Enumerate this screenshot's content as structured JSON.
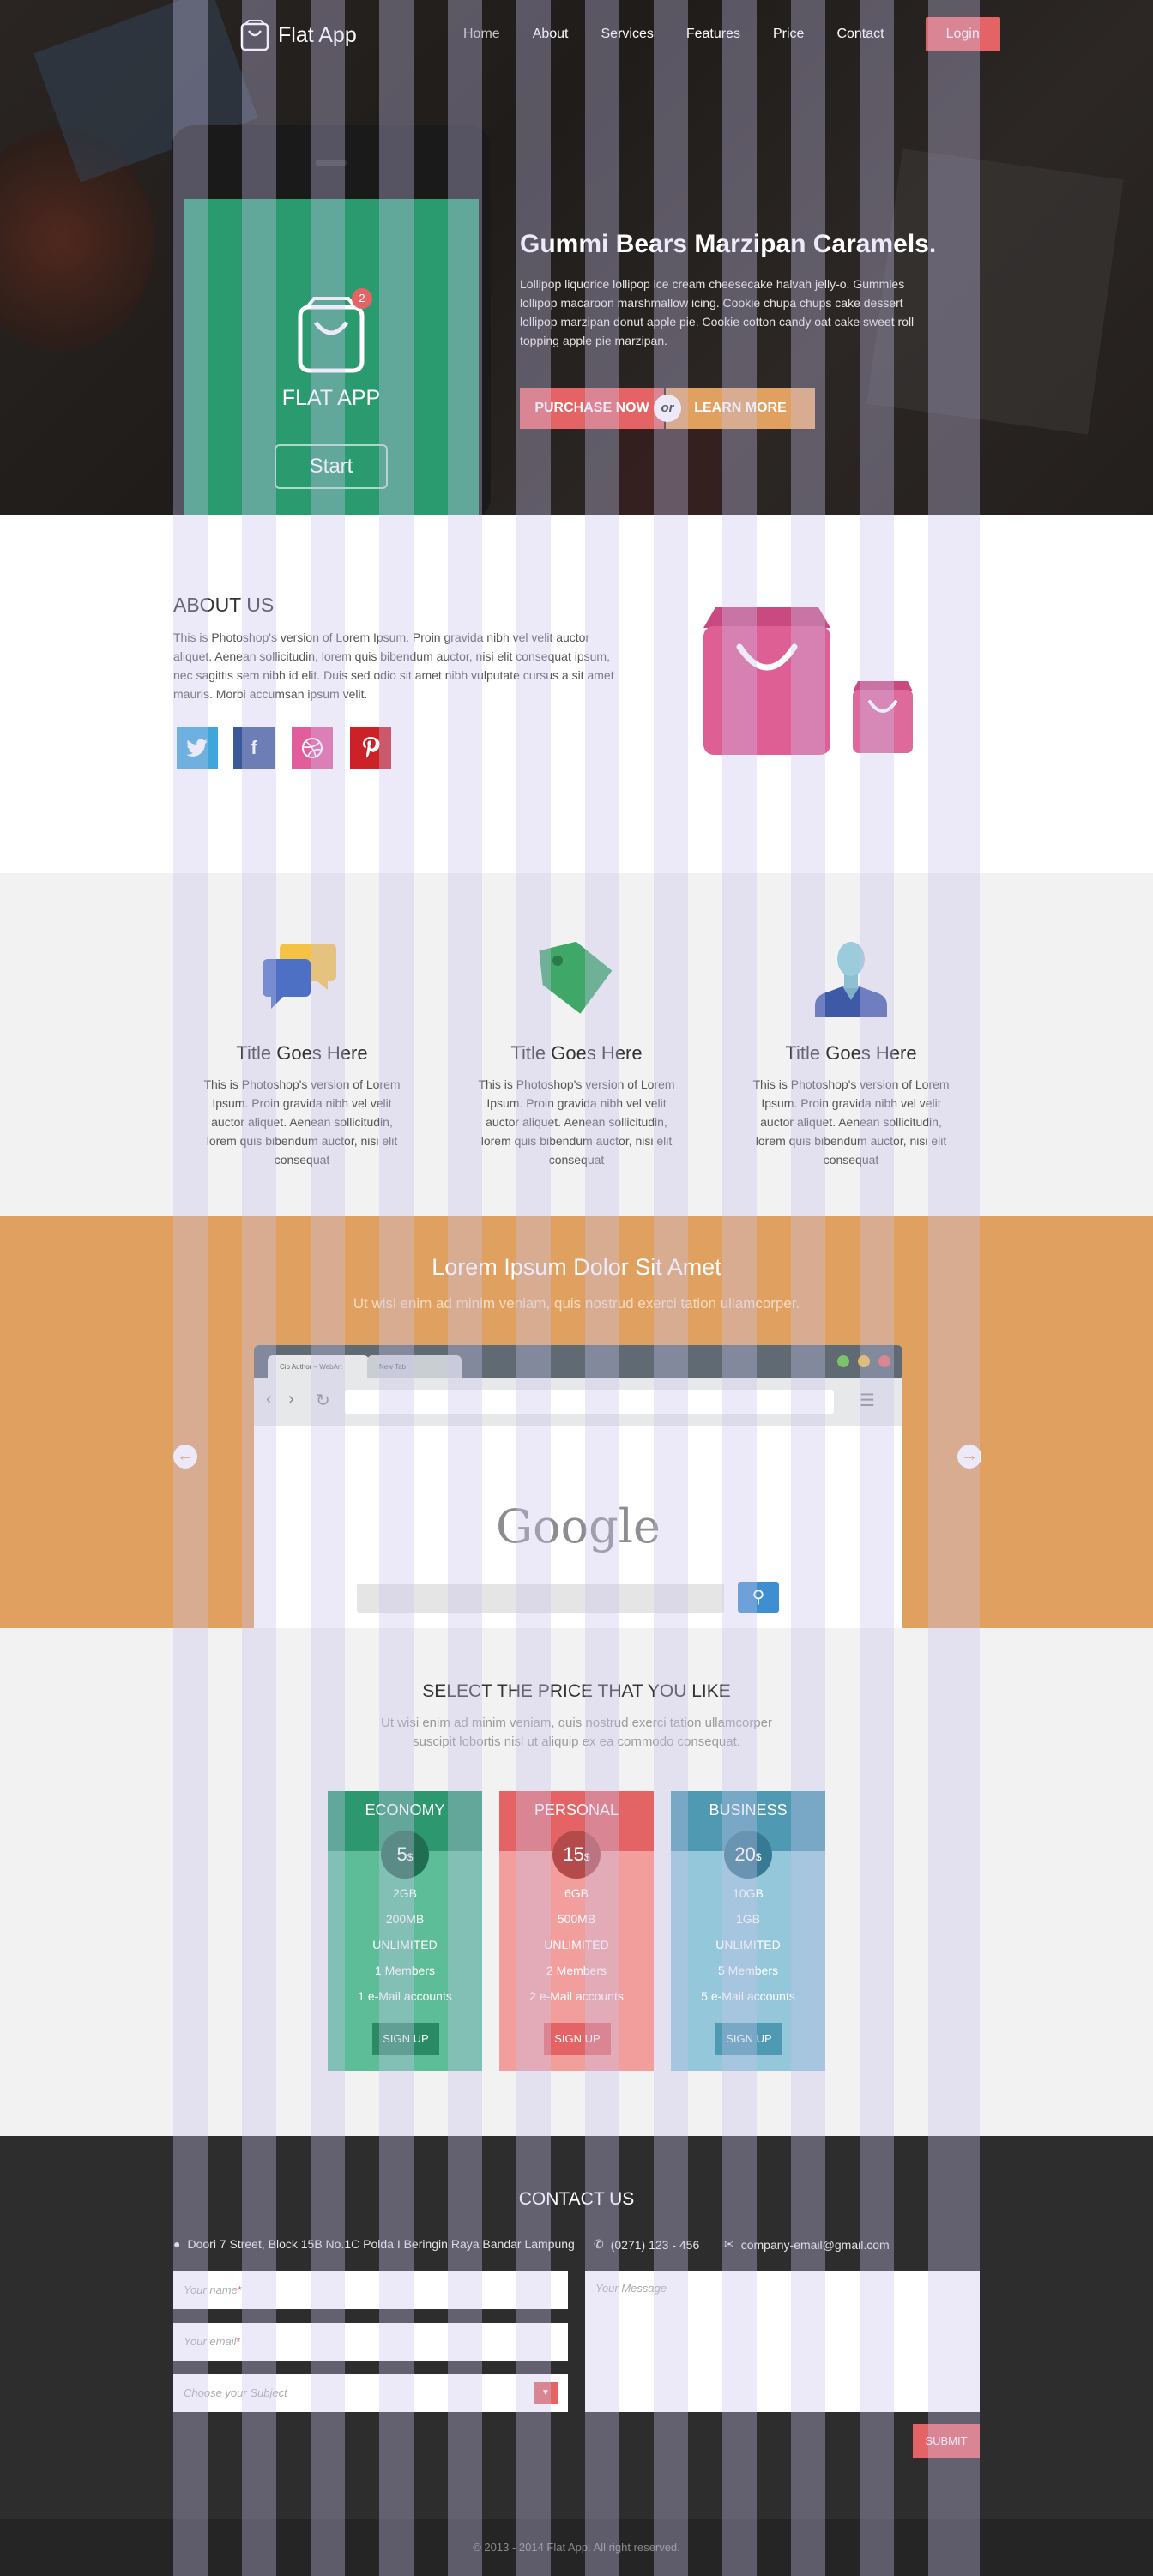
{
  "colors": {
    "accent_red": "#e46466",
    "accent_orange": "#e0a060",
    "green": "#2a9a6f",
    "blue": "#4f99b3",
    "dark": "#2d2d2d"
  },
  "nav": {
    "brand": "Flat App",
    "links": [
      "Home",
      "About",
      "Services",
      "Features",
      "Price",
      "Contact"
    ],
    "login": "Login"
  },
  "hero": {
    "app_badge": "2",
    "app_title": "FLAT APP",
    "start": "Start",
    "headline": "Gummi Bears Marzipan Caramels.",
    "text": "Lollipop liquorice lollipop ice cream cheesecake halvah jelly-o. Gummies lollipop macaroon marshmallow icing. Cookie chupa chups cake dessert lollipop marzipan donut apple pie. Cookie cotton candy oat cake sweet roll topping apple pie marzipan.",
    "purchase": "PURCHASE NOW",
    "or": "or",
    "learn": "LEARN MORE"
  },
  "about": {
    "title": "ABOUT US",
    "text": "This is Photoshop's version  of Lorem Ipsum. Proin gravida nibh vel velit auctor aliquet. Aenean sollicitudin, lorem quis bibendum auctor, nisi elit consequat ipsum, nec sagittis sem nibh id elit. Duis sed odio sit amet nibh vulputate cursus a sit amet mauris. Morbi accumsan ipsum velit.",
    "social_icons": [
      "twitter-icon",
      "facebook-icon",
      "dribbble-icon",
      "pinterest-icon"
    ]
  },
  "features": [
    {
      "icon": "chat-bubbles-icon",
      "title": "Title Goes Here",
      "text": "This is Photoshop's version  of Lorem Ipsum. Proin gravida nibh vel velit auctor aliquet. Aenean sollicitudin, lorem quis bibendum auctor, nisi elit consequat"
    },
    {
      "icon": "price-tag-icon",
      "title": "Title Goes Here",
      "text": "This is Photoshop's version  of Lorem Ipsum. Proin gravida nibh vel velit auctor aliquet. Aenean sollicitudin, lorem quis bibendum auctor, nisi elit consequat"
    },
    {
      "icon": "user-icon",
      "title": "Title Goes Here",
      "text": "This is Photoshop's version  of Lorem Ipsum. Proin gravida nibh vel velit auctor aliquet. Aenean sollicitudin, lorem quis bibendum auctor, nisi elit consequat"
    }
  ],
  "showcase": {
    "title": "Lorem Ipsum Dolor Sit Amet",
    "subtitle": "Ut wisi enim ad minim veniam, quis nostrud exerci tation ullamcorper.",
    "tab1": "Cip Author – WebArt",
    "tab2": "New Tab",
    "google": "Google"
  },
  "pricing": {
    "title": "SELECT THE PRICE THAT YOU LIKE",
    "subtitle": "Ut wisi enim ad minim veniam, quis nostrud exerci tation ullamcorper suscipit lobortis nisl ut aliquip ex ea commodo consequat.",
    "currency": "$",
    "plans": [
      {
        "name": "ECONOMY",
        "price": "5",
        "features": [
          "2GB",
          "200MB",
          "UNLIMITED",
          "1 Members",
          "1 e-Mail accounts"
        ],
        "cta": "SIGN UP"
      },
      {
        "name": "PERSONAL",
        "price": "15",
        "features": [
          "6GB",
          "500MB",
          "UNLIMITED",
          "2 Members",
          "2 e-Mail accounts"
        ],
        "cta": "SIGN UP"
      },
      {
        "name": "BUSINESS",
        "price": "20",
        "features": [
          "10GB",
          "1GB",
          "UNLIMITED",
          "5 Members",
          "5 e-Mail accounts"
        ],
        "cta": "SIGN UP"
      }
    ]
  },
  "contact": {
    "title": "CONTACT US",
    "address": "Doori 7 Street, Block 15B No.1C Polda I Beringin Raya Bandar Lampung",
    "phone": "(0271) 123 - 456",
    "email": "company-email@gmail.com",
    "name_placeholder": "Your name",
    "email_placeholder": "Your email",
    "subject_placeholder": "Choose your Subject",
    "message_placeholder": "Your Message",
    "required_mark": "*",
    "submit": "SUBMIT"
  },
  "footer": {
    "copyright": "© 2013 - 2014 Flat App. All right reserved."
  }
}
